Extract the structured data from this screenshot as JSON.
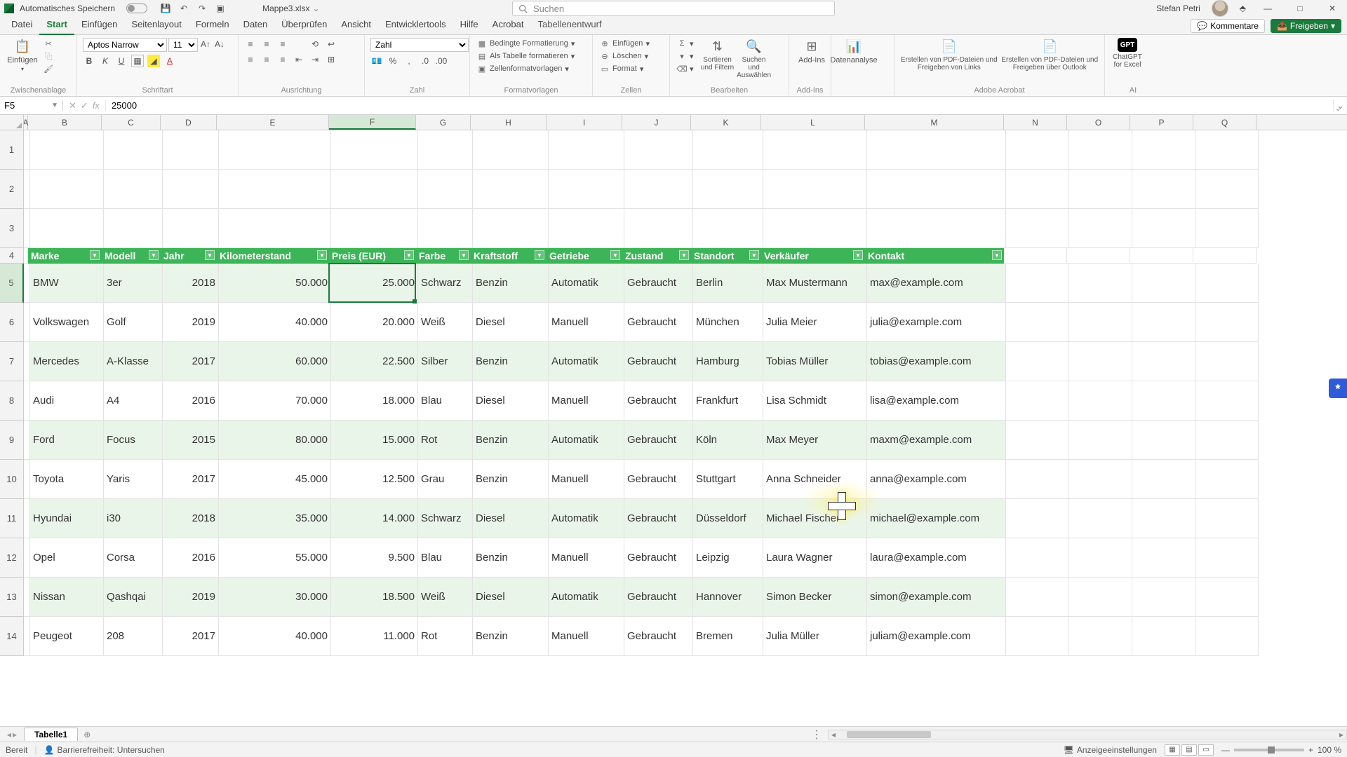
{
  "titlebar": {
    "autosave": "Automatisches Speichern",
    "filename": "Mappe3.xlsx",
    "search_placeholder": "Suchen",
    "user": "Stefan Petri"
  },
  "tabs": {
    "items": [
      "Datei",
      "Start",
      "Einfügen",
      "Seitenlayout",
      "Formeln",
      "Daten",
      "Überprüfen",
      "Ansicht",
      "Entwicklertools",
      "Hilfe",
      "Acrobat",
      "Tabellenentwurf"
    ],
    "active_index": 1,
    "comments": "Kommentare",
    "share": "Freigeben"
  },
  "ribbon": {
    "clipboard": {
      "paste": "Einfügen",
      "label": "Zwischenablage"
    },
    "font": {
      "name": "Aptos Narrow",
      "size": "11",
      "label": "Schriftart"
    },
    "align": {
      "label": "Ausrichtung"
    },
    "number": {
      "format": "Zahl",
      "label": "Zahl"
    },
    "styles": {
      "cond": "Bedingte Formatierung",
      "astable": "Als Tabelle formatieren",
      "cell": "Zellenformatvorlagen",
      "label": "Formatvorlagen"
    },
    "cells": {
      "insert": "Einfügen",
      "delete": "Löschen",
      "format": "Format",
      "label": "Zellen"
    },
    "edit": {
      "sort": "Sortieren und Filtern",
      "find": "Suchen und Auswählen",
      "label": "Bearbeiten"
    },
    "addins": {
      "addins": "Add-Ins",
      "label": "Add-Ins"
    },
    "data": {
      "analysis": "Datenanalyse"
    },
    "acrobat": {
      "a": "Erstellen von PDF-Dateien und Freigeben von Links",
      "b": "Erstellen von PDF-Dateien und Freigeben über Outlook",
      "label": "Adobe Acrobat"
    },
    "ai": {
      "gpt": "ChatGPT for Excel",
      "label": "AI"
    }
  },
  "formula": {
    "cell_ref": "F5",
    "value": "25000"
  },
  "cols": [
    "A",
    "B",
    "C",
    "D",
    "E",
    "F",
    "G",
    "H",
    "I",
    "J",
    "K",
    "L",
    "M",
    "N",
    "O",
    "P",
    "Q"
  ],
  "rowlabels": [
    "1",
    "2",
    "3",
    "4",
    "5",
    "6",
    "7",
    "8",
    "9",
    "10",
    "11",
    "12",
    "13",
    "14"
  ],
  "headers": [
    "Marke",
    "Modell",
    "Jahr",
    "Kilometerstand",
    "Preis (EUR)",
    "Farbe",
    "Kraftstoff",
    "Getriebe",
    "Zustand",
    "Standort",
    "Verkäufer",
    "Kontakt"
  ],
  "rows": [
    {
      "marke": "BMW",
      "modell": "3er",
      "jahr": "2018",
      "km": "50.000",
      "preis": "25.000",
      "farbe": "Schwarz",
      "kraft": "Benzin",
      "getr": "Automatik",
      "zust": "Gebraucht",
      "ort": "Berlin",
      "verk": "Max Mustermann",
      "kont": "max@example.com"
    },
    {
      "marke": "Volkswagen",
      "modell": "Golf",
      "jahr": "2019",
      "km": "40.000",
      "preis": "20.000",
      "farbe": "Weiß",
      "kraft": "Diesel",
      "getr": "Manuell",
      "zust": "Gebraucht",
      "ort": "München",
      "verk": "Julia Meier",
      "kont": "julia@example.com"
    },
    {
      "marke": "Mercedes",
      "modell": "A-Klasse",
      "jahr": "2017",
      "km": "60.000",
      "preis": "22.500",
      "farbe": "Silber",
      "kraft": "Benzin",
      "getr": "Automatik",
      "zust": "Gebraucht",
      "ort": "Hamburg",
      "verk": "Tobias Müller",
      "kont": "tobias@example.com"
    },
    {
      "marke": "Audi",
      "modell": "A4",
      "jahr": "2016",
      "km": "70.000",
      "preis": "18.000",
      "farbe": "Blau",
      "kraft": "Diesel",
      "getr": "Manuell",
      "zust": "Gebraucht",
      "ort": "Frankfurt",
      "verk": "Lisa Schmidt",
      "kont": "lisa@example.com"
    },
    {
      "marke": "Ford",
      "modell": "Focus",
      "jahr": "2015",
      "km": "80.000",
      "preis": "15.000",
      "farbe": "Rot",
      "kraft": "Benzin",
      "getr": "Automatik",
      "zust": "Gebraucht",
      "ort": "Köln",
      "verk": "Max Meyer",
      "kont": "maxm@example.com"
    },
    {
      "marke": "Toyota",
      "modell": "Yaris",
      "jahr": "2017",
      "km": "45.000",
      "preis": "12.500",
      "farbe": "Grau",
      "kraft": "Benzin",
      "getr": "Manuell",
      "zust": "Gebraucht",
      "ort": "Stuttgart",
      "verk": "Anna Schneider",
      "kont": "anna@example.com"
    },
    {
      "marke": "Hyundai",
      "modell": "i30",
      "jahr": "2018",
      "km": "35.000",
      "preis": "14.000",
      "farbe": "Schwarz",
      "kraft": "Diesel",
      "getr": "Automatik",
      "zust": "Gebraucht",
      "ort": "Düsseldorf",
      "verk": "Michael Fischer",
      "kont": "michael@example.com"
    },
    {
      "marke": "Opel",
      "modell": "Corsa",
      "jahr": "2016",
      "km": "55.000",
      "preis": "9.500",
      "farbe": "Blau",
      "kraft": "Benzin",
      "getr": "Manuell",
      "zust": "Gebraucht",
      "ort": "Leipzig",
      "verk": "Laura Wagner",
      "kont": "laura@example.com"
    },
    {
      "marke": "Nissan",
      "modell": "Qashqai",
      "jahr": "2019",
      "km": "30.000",
      "preis": "18.500",
      "farbe": "Weiß",
      "kraft": "Diesel",
      "getr": "Automatik",
      "zust": "Gebraucht",
      "ort": "Hannover",
      "verk": "Simon Becker",
      "kont": "simon@example.com"
    },
    {
      "marke": "Peugeot",
      "modell": "208",
      "jahr": "2017",
      "km": "40.000",
      "preis": "11.000",
      "farbe": "Rot",
      "kraft": "Benzin",
      "getr": "Manuell",
      "zust": "Gebraucht",
      "ort": "Bremen",
      "verk": "Julia Müller",
      "kont": "juliam@example.com"
    }
  ],
  "sheet": {
    "name": "Tabelle1"
  },
  "status": {
    "ready": "Bereit",
    "access": "Barrierefreiheit: Untersuchen",
    "display": "Anzeigeeinstellungen",
    "zoom": "100 %"
  }
}
